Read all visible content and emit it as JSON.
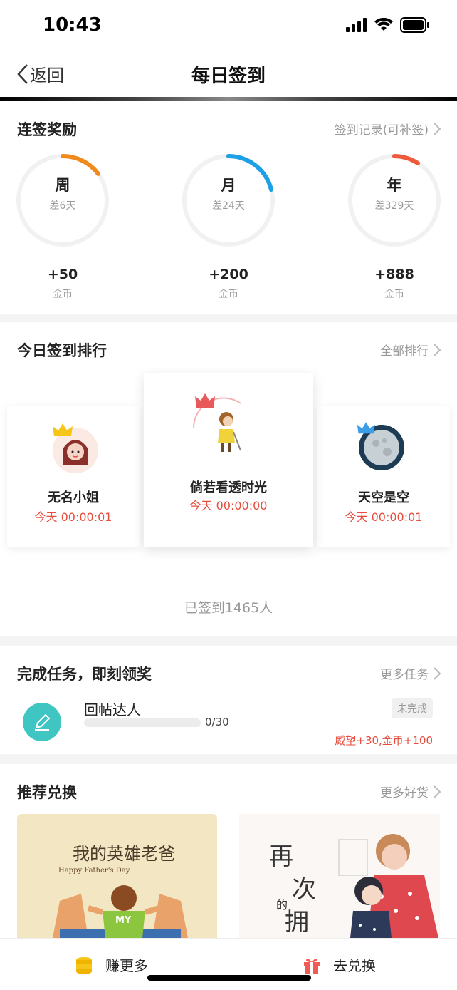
{
  "status": {
    "time": "10:43"
  },
  "nav": {
    "back_label": "返回",
    "title": "每日签到"
  },
  "streak": {
    "title": "连签奖励",
    "link": "签到记录(可补签)",
    "items": [
      {
        "label": "周",
        "sub": "差6天",
        "reward": "+50",
        "unit": "金币",
        "color": "#f08a1c"
      },
      {
        "label": "月",
        "sub": "差24天",
        "reward": "+200",
        "unit": "金币",
        "color": "#1ea0e6"
      },
      {
        "label": "年",
        "sub": "差329天",
        "reward": "+888",
        "unit": "金币",
        "color": "#f05a3c"
      }
    ]
  },
  "ranking": {
    "title": "今日签到排行",
    "link": "全部排行",
    "entries": [
      {
        "name": "无名小姐",
        "time": "今天 00:00:01"
      },
      {
        "name": "倘若看透时光",
        "time": "今天 00:00:00"
      },
      {
        "name": "天空是空",
        "time": "今天 00:00:01"
      }
    ],
    "signed_count": "已签到1465人"
  },
  "tasks": {
    "title": "完成任务，即刻领奖",
    "link": "更多任务",
    "items": [
      {
        "name": "回帖达人",
        "progress_text": "0/30",
        "progress": 0,
        "status": "未完成",
        "reward": "威望+30,金币+100"
      }
    ]
  },
  "exchange": {
    "title": "推荐兑换",
    "link": "更多好货",
    "item1": {
      "title": "我的英雄老爸",
      "subtitle": "Happy Father's Day",
      "shirt": "MY"
    },
    "item2": {
      "text": [
        "再",
        "次",
        "的",
        "拥"
      ]
    }
  },
  "bottom": {
    "earn_label": "赚更多",
    "exchange_label": "去兑换"
  },
  "colors": {
    "accent_red": "#e74c3c",
    "teal": "#3fc6c2",
    "coin": "#f5c518"
  }
}
